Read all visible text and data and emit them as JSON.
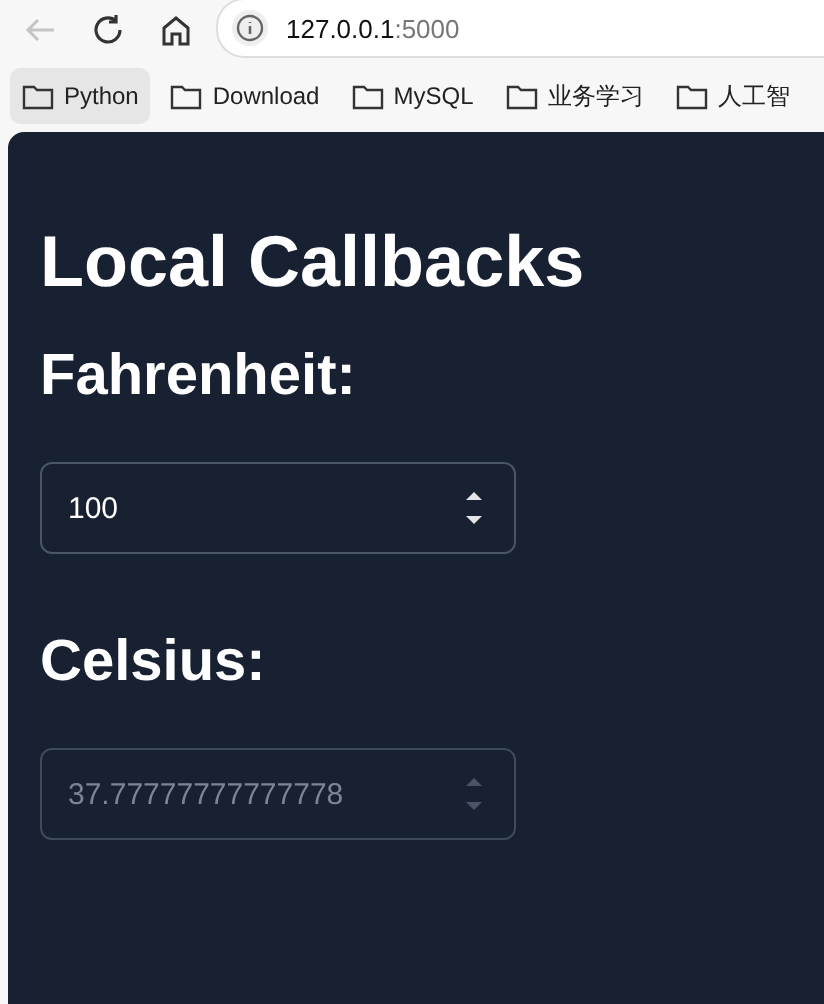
{
  "browser": {
    "back_disabled": true,
    "url_host": "127.0.0.1",
    "url_port": ":5000"
  },
  "bookmarks": [
    {
      "label": "Python",
      "selected": true
    },
    {
      "label": "Download",
      "selected": false
    },
    {
      "label": "MySQL",
      "selected": false
    },
    {
      "label": "业务学习",
      "selected": false
    },
    {
      "label": "人工智",
      "selected": false
    }
  ],
  "page": {
    "title": "Local Callbacks",
    "fields": [
      {
        "label": "Fahrenheit:",
        "value": "100",
        "disabled": false
      },
      {
        "label": "Celsius:",
        "value": "37.77777777777778",
        "disabled": true
      }
    ]
  }
}
